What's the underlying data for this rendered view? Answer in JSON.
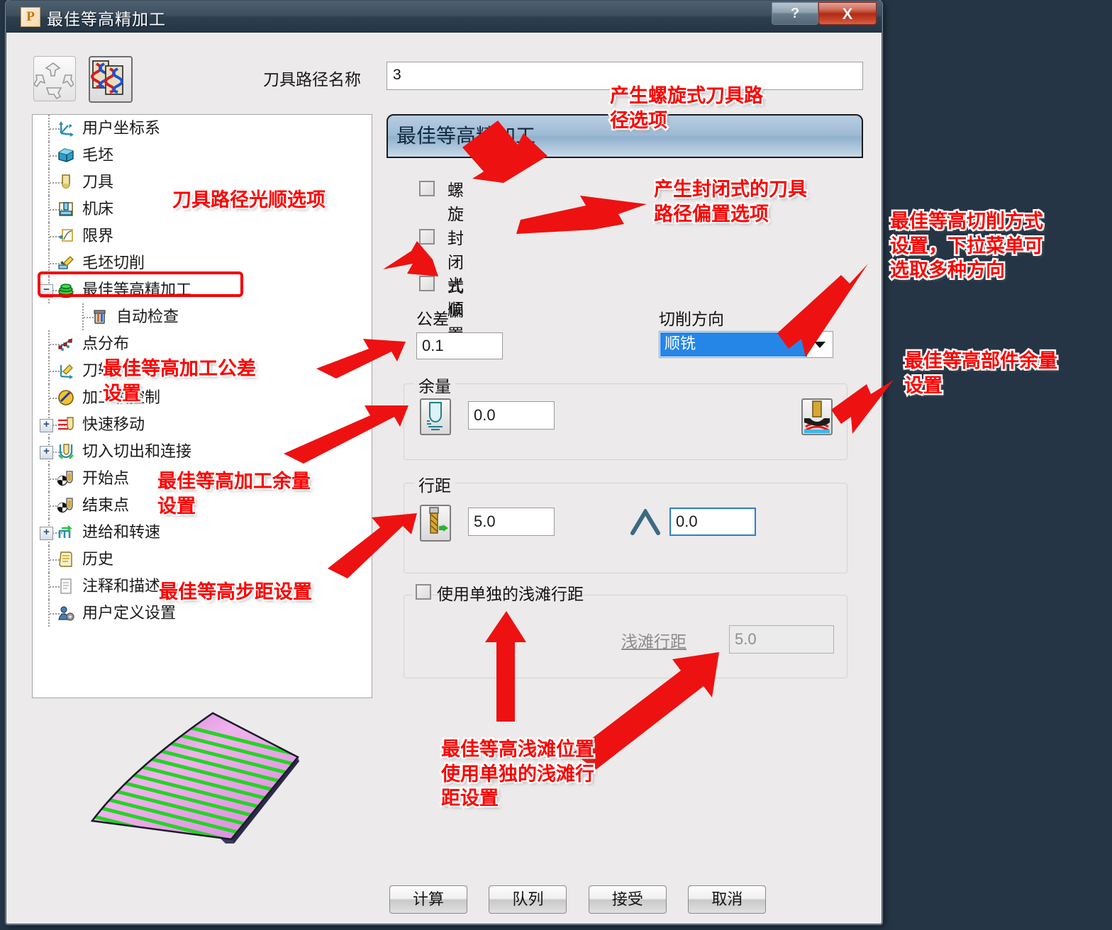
{
  "window": {
    "title": "最佳等高精加工",
    "app_icon": "P",
    "help_button": "?",
    "close_button": "X"
  },
  "toolbar": {
    "buttons": [
      {
        "name": "recycle-icon",
        "label": ""
      },
      {
        "name": "toolpath-preview-icon",
        "label": ""
      }
    ]
  },
  "toolpath": {
    "name_label": "刀具路径名称",
    "name_value": "3"
  },
  "tree": {
    "items": [
      {
        "label": "用户坐标系",
        "icon": "axes-icon",
        "indent": 0,
        "expander": ""
      },
      {
        "label": "毛坯",
        "icon": "block-icon",
        "indent": 0,
        "expander": ""
      },
      {
        "label": "刀具",
        "icon": "tool-icon",
        "indent": 0,
        "expander": ""
      },
      {
        "label": "机床",
        "icon": "machine-icon",
        "indent": 0,
        "expander": ""
      },
      {
        "label": "限界",
        "icon": "boundary-icon",
        "indent": 0,
        "expander": ""
      },
      {
        "label": "毛坯切削",
        "icon": "stock-cut-icon",
        "indent": 0,
        "expander": ""
      },
      {
        "label": "最佳等高精加工",
        "icon": "optimised-constant-z-icon",
        "indent": 0,
        "expander": "−",
        "selected": true
      },
      {
        "label": "自动检查",
        "icon": "auto-check-icon",
        "indent": 1,
        "expander": ""
      },
      {
        "label": "点分布",
        "icon": "point-distribution-icon",
        "indent": 0,
        "expander": ""
      },
      {
        "label": "刀轴",
        "icon": "tool-axis-icon",
        "indent": 0,
        "expander": ""
      },
      {
        "label": "加工轴控制",
        "icon": "machine-axis-control-icon",
        "indent": 0,
        "expander": ""
      },
      {
        "label": "快速移动",
        "icon": "rapid-move-icon",
        "indent": 0,
        "expander": "+"
      },
      {
        "label": "切入切出和连接",
        "icon": "leads-links-icon",
        "indent": 0,
        "expander": "+"
      },
      {
        "label": "开始点",
        "icon": "start-point-icon",
        "indent": 0,
        "expander": ""
      },
      {
        "label": "结束点",
        "icon": "end-point-icon",
        "indent": 0,
        "expander": ""
      },
      {
        "label": "进给和转速",
        "icon": "feeds-speeds-icon",
        "indent": 0,
        "expander": "+"
      },
      {
        "label": "历史",
        "icon": "history-icon",
        "indent": 0,
        "expander": ""
      },
      {
        "label": "注释和描述",
        "icon": "notes-icon",
        "indent": 0,
        "expander": ""
      },
      {
        "label": "用户定义设置",
        "icon": "user-defined-icon",
        "indent": 0,
        "expander": ""
      }
    ]
  },
  "form": {
    "header": "最佳等高精加工",
    "checkboxes": [
      {
        "label": "螺旋",
        "checked": false
      },
      {
        "label": "封闭式偏置",
        "checked": false
      },
      {
        "label": "光顺",
        "checked": false
      }
    ],
    "tolerance": {
      "label": "公差",
      "value": "0.1"
    },
    "cut_direction": {
      "label": "切削方向",
      "value": "顺铣"
    },
    "thickness": {
      "group_label": "余量",
      "value": "0.0",
      "left_icon": "radial-thickness-icon",
      "right_icon": "component-thickness-icon"
    },
    "stepdown": {
      "group_label": "行距",
      "value": "5.0",
      "left_icon": "stepdown-icon",
      "angle_icon": "shallow-angle-icon",
      "angle_value": "0.0"
    },
    "shallow": {
      "checkbox_label": "使用单独的浅滩行距",
      "checked": false,
      "field_label": "浅滩行距",
      "field_value": "5.0",
      "disabled": true
    }
  },
  "buttons": [
    {
      "label": "计算"
    },
    {
      "label": "队列"
    },
    {
      "label": "接受"
    },
    {
      "label": "取消"
    }
  ],
  "annotations": [
    {
      "id": "a1",
      "text": "产生螺旋式刀具路\n径选项"
    },
    {
      "id": "a2",
      "text": "刀具路径光顺选项"
    },
    {
      "id": "a3",
      "text": "产生封闭式的刀具\n路径偏置选项"
    },
    {
      "id": "a4",
      "text": "最佳等高切削方式\n设置，下拉菜单可\n选取多种方向"
    },
    {
      "id": "a5",
      "text": "最佳等高部件余量\n设置"
    },
    {
      "id": "a6",
      "text": "最佳等高加工公差\n设置"
    },
    {
      "id": "a7",
      "text": "最佳等高加工余量\n设置"
    },
    {
      "id": "a8",
      "text": "最佳等高步距设置"
    },
    {
      "id": "a9",
      "text": "最佳等高浅滩位置\n使用单独的浅滩行\n距设置"
    }
  ],
  "colors": {
    "annotation": "#ff0000",
    "titlebar": "#2d3f4e",
    "desktop": "#253545",
    "combo_highlight": "#2586e8",
    "form_header": "#9dbad4",
    "highlight_box": "#f40000"
  }
}
